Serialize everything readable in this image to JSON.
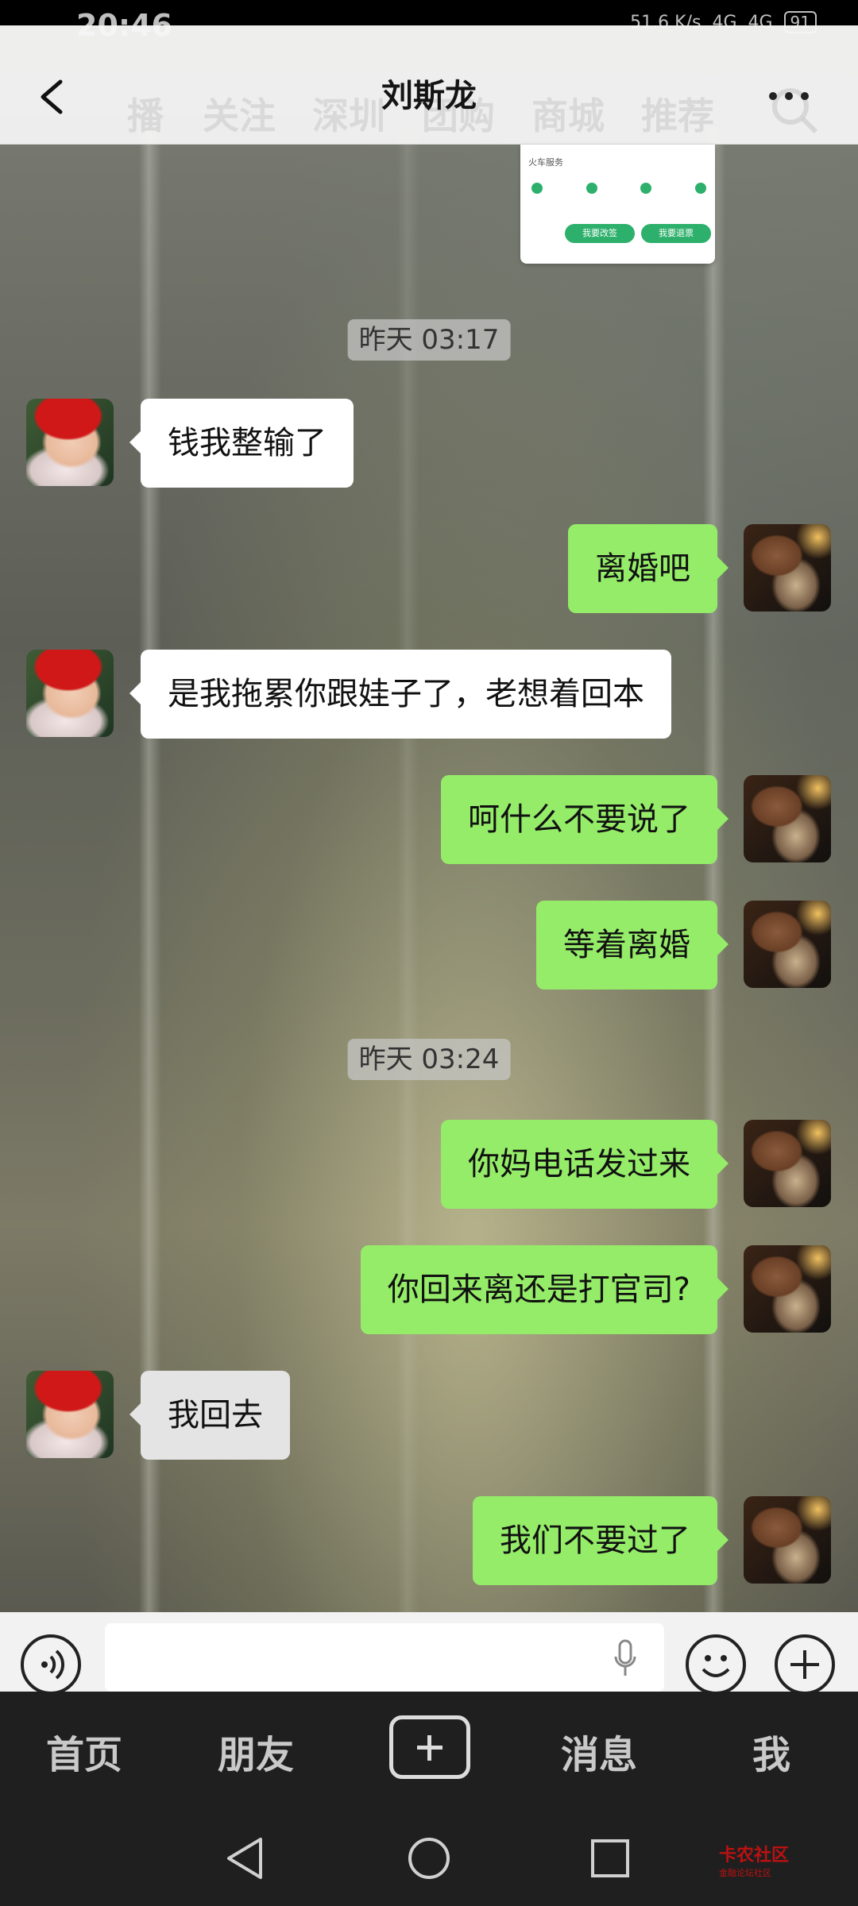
{
  "status_bar": {
    "time": "20:46",
    "net_speed": "51.6 K/s",
    "signal_1": "4G",
    "signal_2": "4G",
    "battery": "91"
  },
  "background_tabs": [
    "播",
    "关注",
    "深圳",
    "团购",
    "商城",
    "推荐"
  ],
  "header": {
    "title": "刘斯龙",
    "back_icon": "chevron-left-icon",
    "more_icon": "more-dots-icon"
  },
  "shared_card": {
    "title": "火车服务",
    "button_1": "我要改签",
    "button_2": "我要退票"
  },
  "messages": [
    {
      "type": "time",
      "text": "昨天 03:17"
    },
    {
      "type": "msg",
      "side": "left",
      "text": "钱我整输了"
    },
    {
      "type": "msg",
      "side": "right",
      "text": "离婚吧"
    },
    {
      "type": "msg",
      "side": "left",
      "text": "是我拖累你跟娃子了，老想着回本"
    },
    {
      "type": "msg",
      "side": "right",
      "text": "呵什么不要说了"
    },
    {
      "type": "msg",
      "side": "right",
      "text": "等着离婚"
    },
    {
      "type": "time",
      "text": "昨天 03:24"
    },
    {
      "type": "msg",
      "side": "right",
      "text": "你妈电话发过来"
    },
    {
      "type": "msg",
      "side": "right",
      "text": "你回来离还是打官司?"
    },
    {
      "type": "msg",
      "side": "left",
      "text": "我回去"
    },
    {
      "type": "msg",
      "side": "right",
      "text": "我们不要过了"
    }
  ],
  "bottom_tabs": {
    "home": "首页",
    "friends": "朋友",
    "messages": "消息",
    "me": "我"
  },
  "watermark": {
    "brand": "卡农社区",
    "sub": "金融论坛社区"
  },
  "colors": {
    "my_bubble": "#95ec69",
    "their_bubble": "#ffffff",
    "tabbar_bg": "#1f1f1f"
  }
}
